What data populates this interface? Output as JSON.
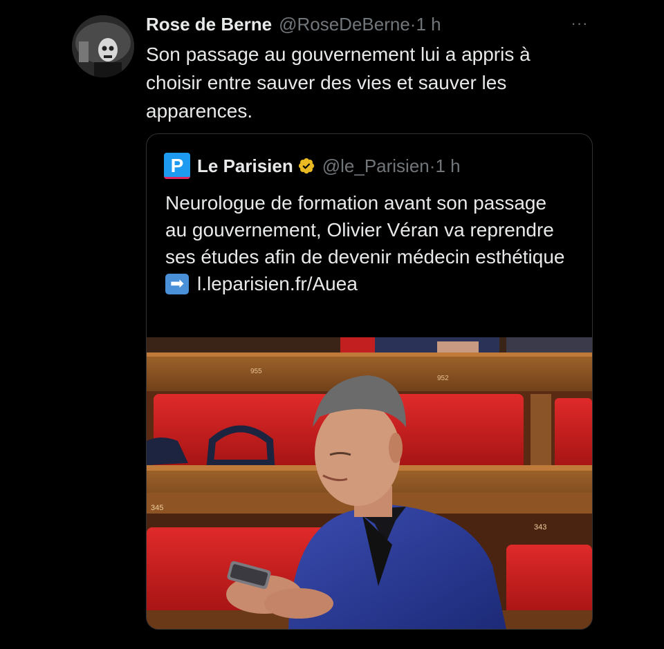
{
  "tweet": {
    "display_name": "Rose de Berne",
    "handle": "@RoseDeBerne",
    "time": "1 h",
    "separator": "·",
    "more_label": "···",
    "text": "Son passage au gouvernement lui a appris à choisir entre sauver des vies et sauver les apparences."
  },
  "quote": {
    "brand_letter": "P",
    "display_name": "Le Parisien",
    "handle": "@le_Parisien",
    "time": "1 h",
    "separator": "·",
    "text": "Neurologue de formation avant son passage au gouvernement, Olivier Véran va reprendre ses études afin de devenir médecin esthétique",
    "link_icon": "➡",
    "link_text": "l.leparisien.fr/Auea"
  },
  "photo": {
    "seat_numbers": [
      "955",
      "952",
      "345",
      "343"
    ]
  },
  "colors": {
    "background": "#000000",
    "text_primary": "#e7e9ea",
    "text_secondary": "#71767b",
    "border": "#2f3336",
    "verified_gold": "#e8b923",
    "brand_blue": "#1d9bf0"
  },
  "icons": {
    "more": "more-horizontal-icon",
    "verified": "verified-badge-icon",
    "link": "arrow-right-icon"
  }
}
